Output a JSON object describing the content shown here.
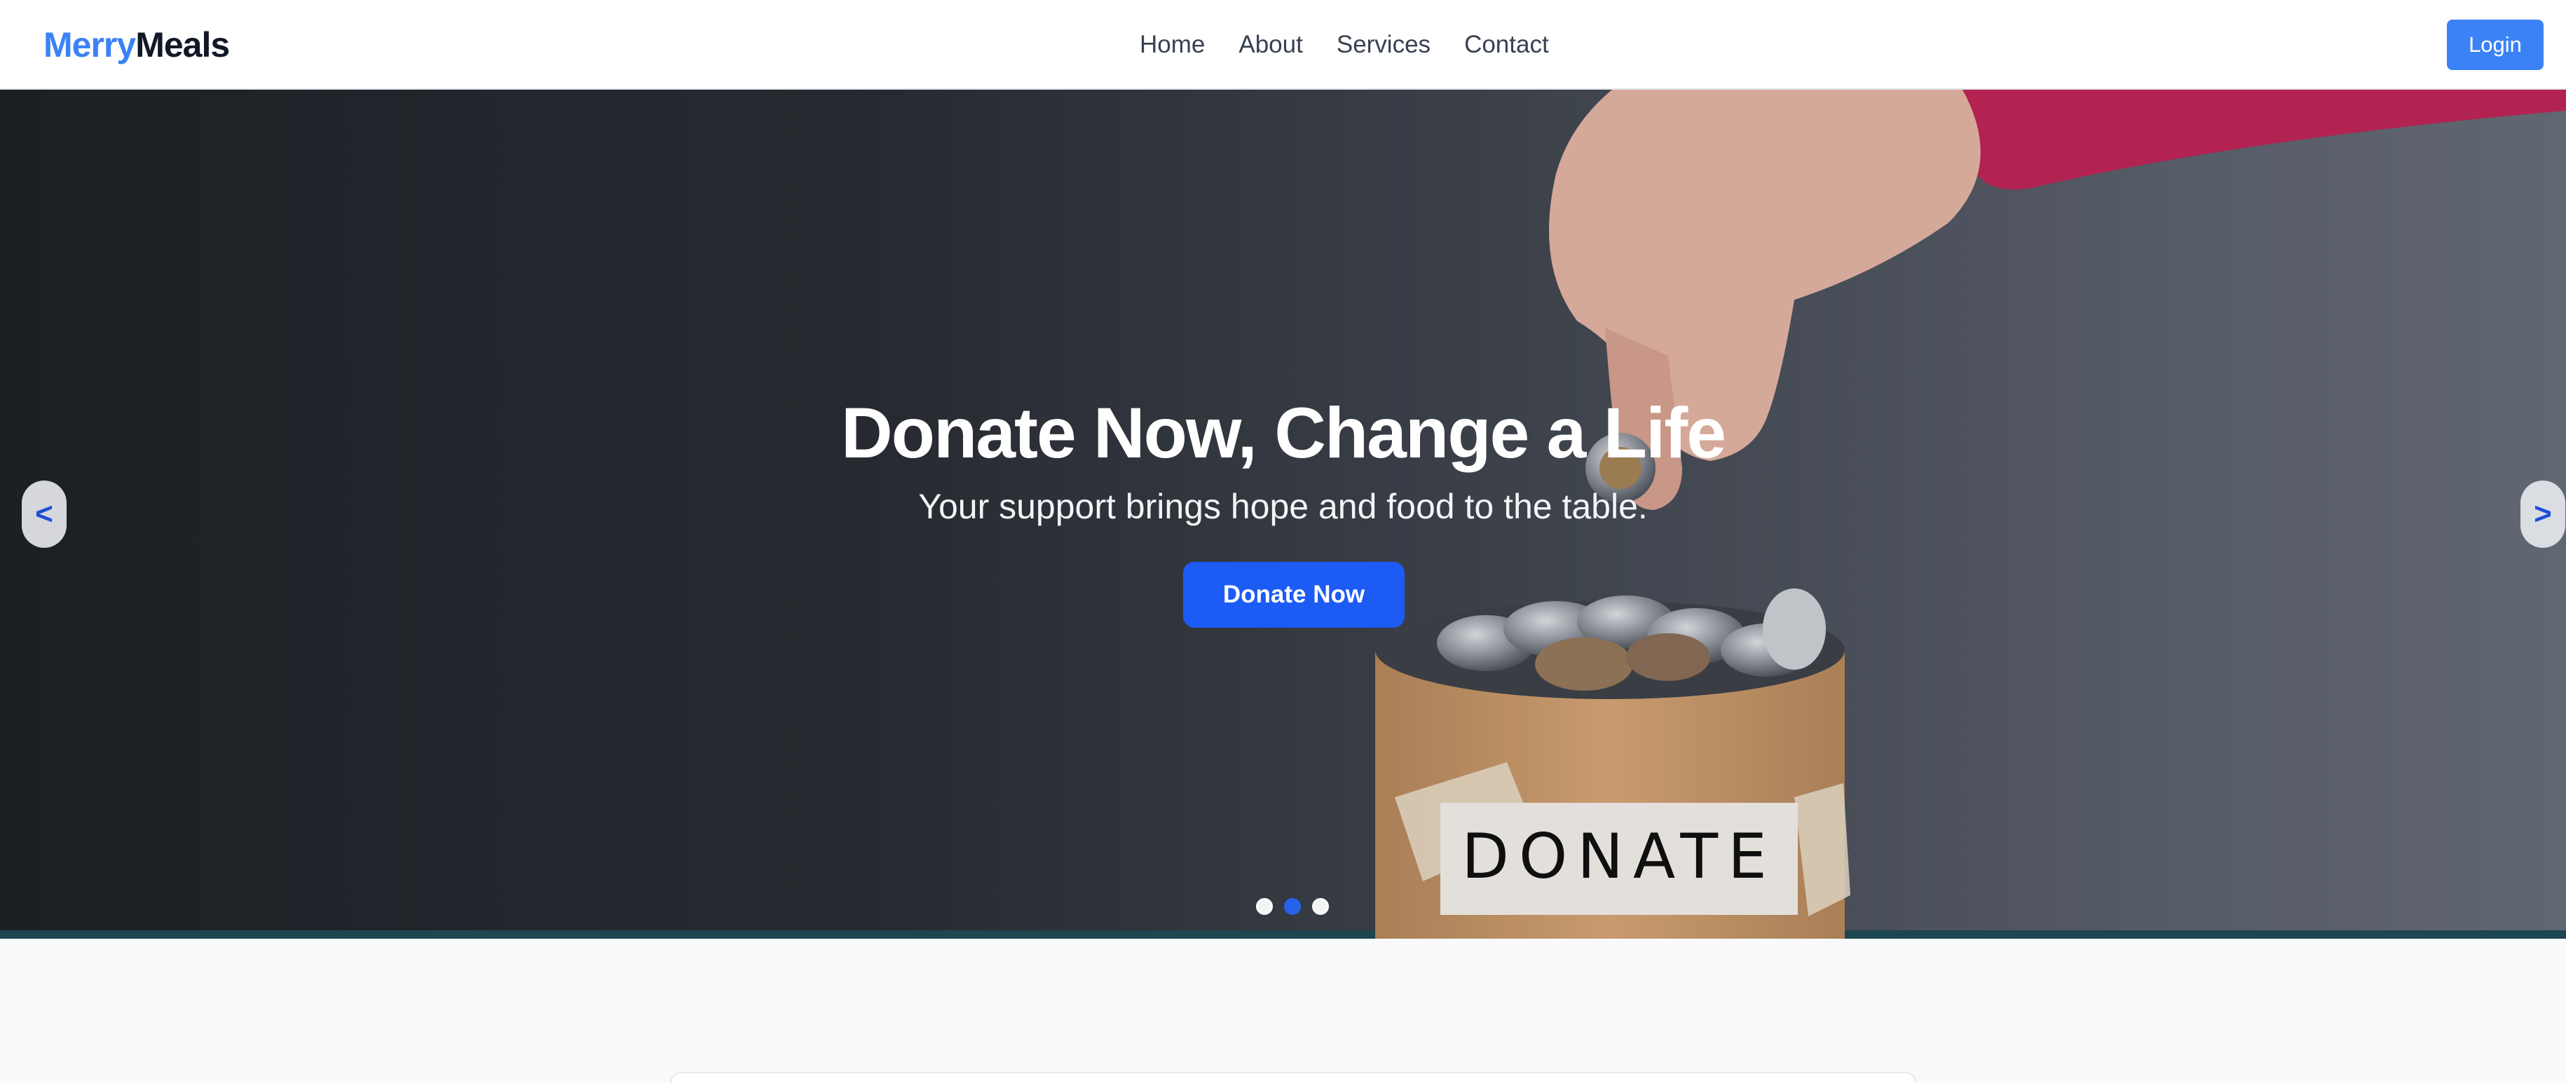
{
  "brand": {
    "part1": "Merry",
    "part2": "Meals"
  },
  "nav": {
    "items": [
      {
        "label": "Home"
      },
      {
        "label": "About"
      },
      {
        "label": "Services"
      },
      {
        "label": "Contact"
      }
    ]
  },
  "header": {
    "login_label": "Login"
  },
  "hero": {
    "title": "Donate Now, Change a Life",
    "subtitle": "Your support brings hope and food to the table.",
    "cta_label": "Donate Now",
    "jar_label": "DONATE",
    "prev_label": "<",
    "next_label": ">",
    "slides": {
      "count": 3,
      "active_index": 1
    }
  },
  "colors": {
    "accent": "#3b82f6",
    "cta": "#1d5bf5",
    "brand_dark": "#111827"
  },
  "icons": {
    "prev": "chevron-left-icon",
    "next": "chevron-right-icon"
  }
}
